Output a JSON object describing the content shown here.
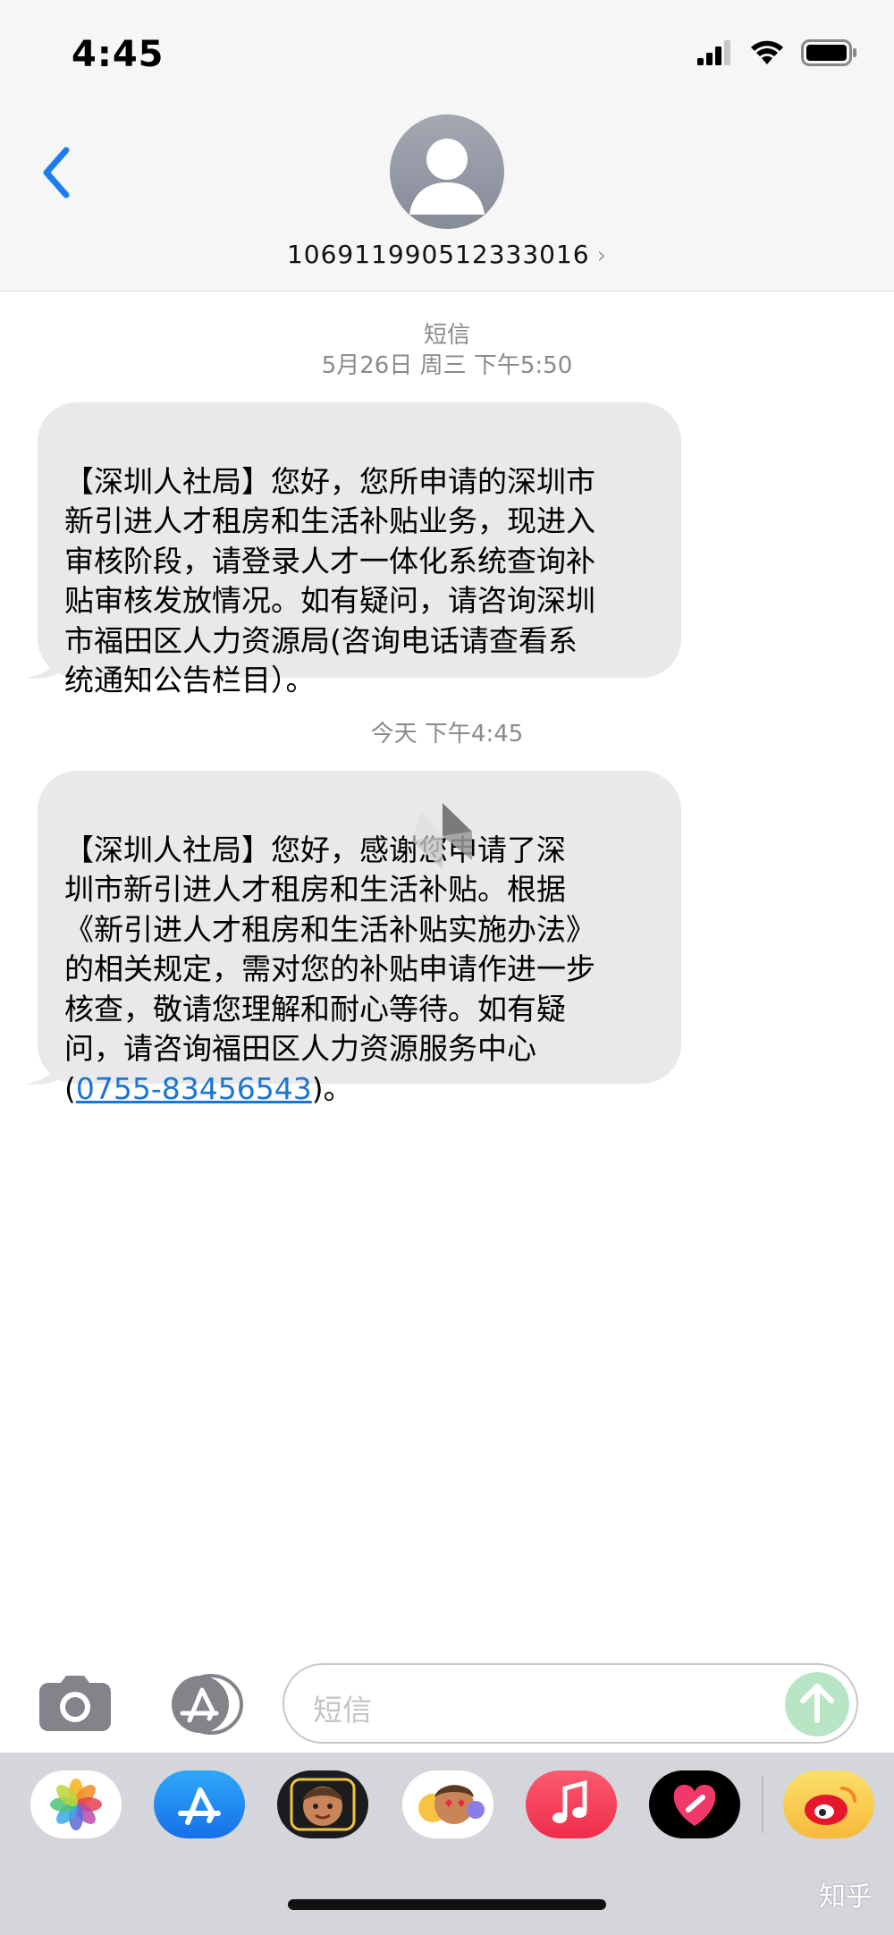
{
  "status_bar": {
    "time": "4:45"
  },
  "header": {
    "contact_number": "106911990512333016"
  },
  "thread": {
    "first_stamp_label": "短信",
    "first_stamp_time": "5月26日 周三 下午5:50",
    "message1": "【深圳人社局】您好，您所申请的深圳市\n新引进人才租房和生活补贴业务，现进入\n审核阶段，请登录人才一体化系统查询补\n贴审核发放情况。如有疑问，请咨询深圳\n市福田区人力资源局(咨询电话请查看系\n统通知公告栏目）。",
    "second_stamp_time": "今天 下午4:45",
    "message2_before_link": "【深圳人社局】您好，感谢您申请了深\n圳市新引进人才租房和生活补贴。根据\n《新引进人才租房和生活补贴实施办法》\n的相关规定，需对您的补贴申请作进一步\n核查，敬请您理解和耐心等待。如有疑\n问，请咨询福田区人力资源服务中心\n(",
    "message2_link": "0755-83456543",
    "message2_after_link": ")。"
  },
  "composer": {
    "placeholder": "短信"
  },
  "watermark": "知乎",
  "colors": {
    "header_bg": "#f6f6f6",
    "bubble_bg": "#e9e9eb",
    "accent_blue": "#1a76d2",
    "send_green": "#b8e5c4"
  }
}
